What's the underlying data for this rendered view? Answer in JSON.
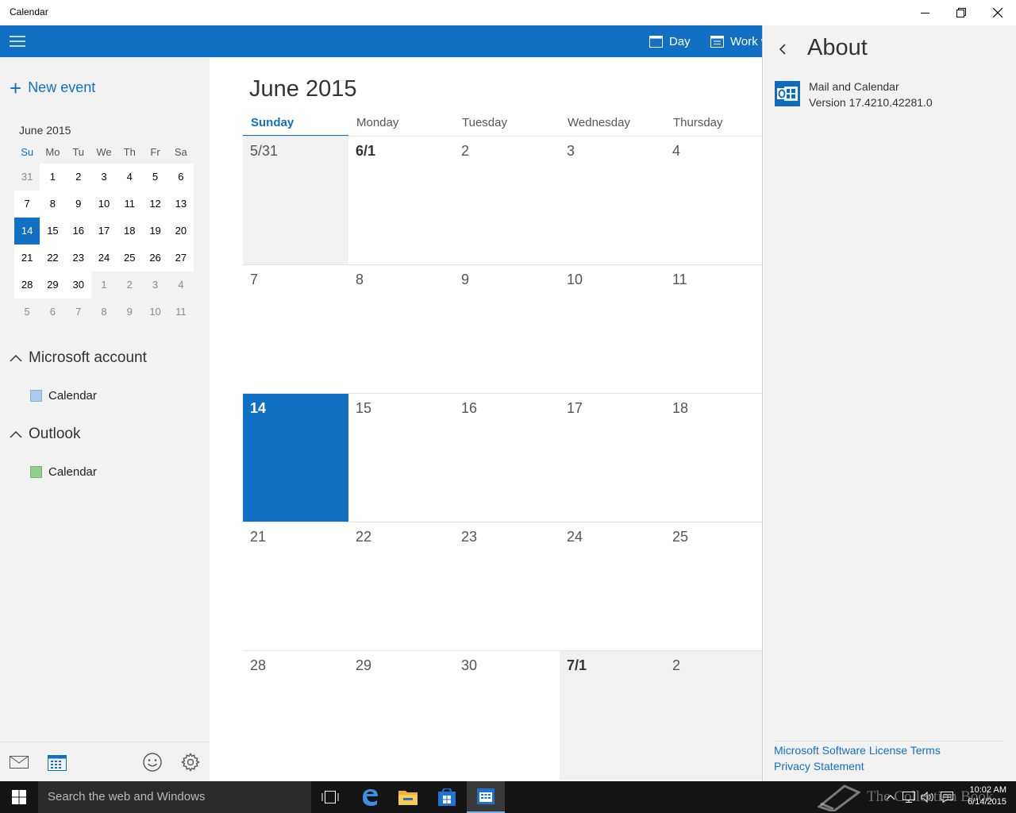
{
  "window": {
    "title": "Calendar",
    "controls": {
      "minimize": "minimize",
      "restore": "restore",
      "close": "close"
    }
  },
  "commandbar": {
    "items": [
      {
        "label": "Day",
        "icon": "day-view-icon"
      },
      {
        "label": "Work w",
        "icon": "work-week-icon"
      }
    ]
  },
  "sidebar": {
    "new_event": "New event",
    "mini_calendar": {
      "title": "June 2015",
      "weekdays": [
        "Su",
        "Mo",
        "Tu",
        "We",
        "Th",
        "Fr",
        "Sa"
      ],
      "weeks": [
        [
          "31",
          "1",
          "2",
          "3",
          "4",
          "5",
          "6"
        ],
        [
          "7",
          "8",
          "9",
          "10",
          "11",
          "12",
          "13"
        ],
        [
          "14",
          "15",
          "16",
          "17",
          "18",
          "19",
          "20"
        ],
        [
          "21",
          "22",
          "23",
          "24",
          "25",
          "26",
          "27"
        ],
        [
          "28",
          "29",
          "30",
          "1",
          "2",
          "3",
          "4"
        ],
        [
          "5",
          "6",
          "7",
          "8",
          "9",
          "10",
          "11"
        ]
      ],
      "selected": "14"
    },
    "accounts": [
      {
        "name": "Microsoft account",
        "calendars": [
          {
            "label": "Calendar",
            "color": "#a8cdf0"
          }
        ]
      },
      {
        "name": "Outlook",
        "calendars": [
          {
            "label": "Calendar",
            "color": "#8fd08a"
          }
        ]
      }
    ],
    "bottom_icons": [
      "mail-icon",
      "calendar-icon",
      "feedback-smiley-icon",
      "settings-gear-icon"
    ]
  },
  "main": {
    "month_title": "June 2015",
    "weekdays": [
      "Sunday",
      "Monday",
      "Tuesday",
      "Wednesday",
      "Thursday"
    ],
    "active_weekday": "Sunday",
    "weeks": [
      [
        "5/31",
        "6/1",
        "2",
        "3",
        "4"
      ],
      [
        "7",
        "8",
        "9",
        "10",
        "11"
      ],
      [
        "14",
        "15",
        "16",
        "17",
        "18"
      ],
      [
        "21",
        "22",
        "23",
        "24",
        "25"
      ],
      [
        "28",
        "29",
        "30",
        "7/1",
        "2"
      ]
    ],
    "today": "14"
  },
  "about": {
    "title": "About",
    "app_name": "Mail and Calendar",
    "version": "Version 17.4210.42281.0",
    "links": [
      "Microsoft Software License Terms",
      "Privacy Statement"
    ]
  },
  "taskbar": {
    "search_placeholder": "Search the web and Windows",
    "apps": [
      "task-view-icon",
      "edge-icon",
      "file-explorer-icon",
      "store-icon",
      "calendar-app-icon"
    ],
    "time": "10:02 AM",
    "date": "6/14/2015",
    "watermark": "The Collection Book"
  },
  "colors": {
    "accent": "#1170c4",
    "pane": "#f2f2f2",
    "taskbar": "#141414"
  }
}
